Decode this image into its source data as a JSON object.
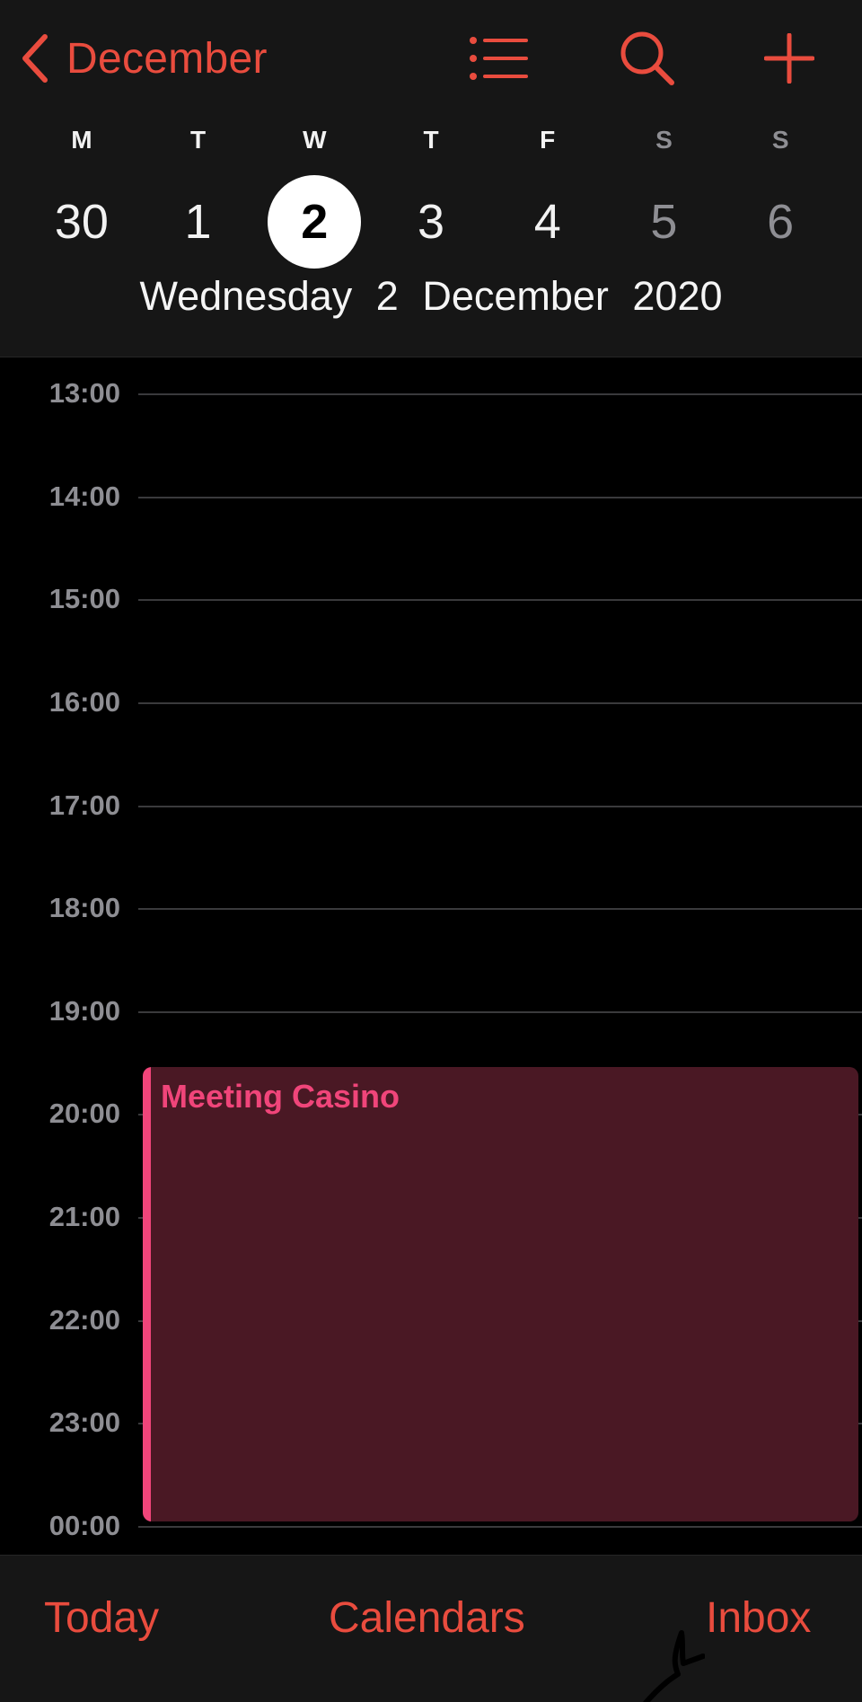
{
  "header": {
    "back_label": "December",
    "icons": {
      "list": "list-icon",
      "search": "search-icon",
      "add": "plus-icon",
      "back": "chevron-left-icon"
    },
    "weekdays": [
      "M",
      "T",
      "W",
      "T",
      "F",
      "S",
      "S"
    ],
    "dates": [
      "30",
      "1",
      "2",
      "3",
      "4",
      "5",
      "6"
    ],
    "selected_index": 2,
    "full_date": "Wednesday  2 December 2020"
  },
  "timeline": {
    "hours": [
      "13:00",
      "14:00",
      "15:00",
      "16:00",
      "17:00",
      "18:00",
      "19:00",
      "20:00",
      "21:00",
      "22:00",
      "23:00",
      "00:00"
    ]
  },
  "event": {
    "title": "Meeting Casino",
    "color": "#f0457a",
    "background": "#4a1824"
  },
  "toolbar": {
    "today_label": "Today",
    "calendars_label": "Calendars",
    "inbox_label": "Inbox"
  },
  "colors": {
    "accent": "#e94c3e",
    "header_bg": "#161616",
    "body_bg": "#000000",
    "weekend_text": "#8e8e93"
  }
}
